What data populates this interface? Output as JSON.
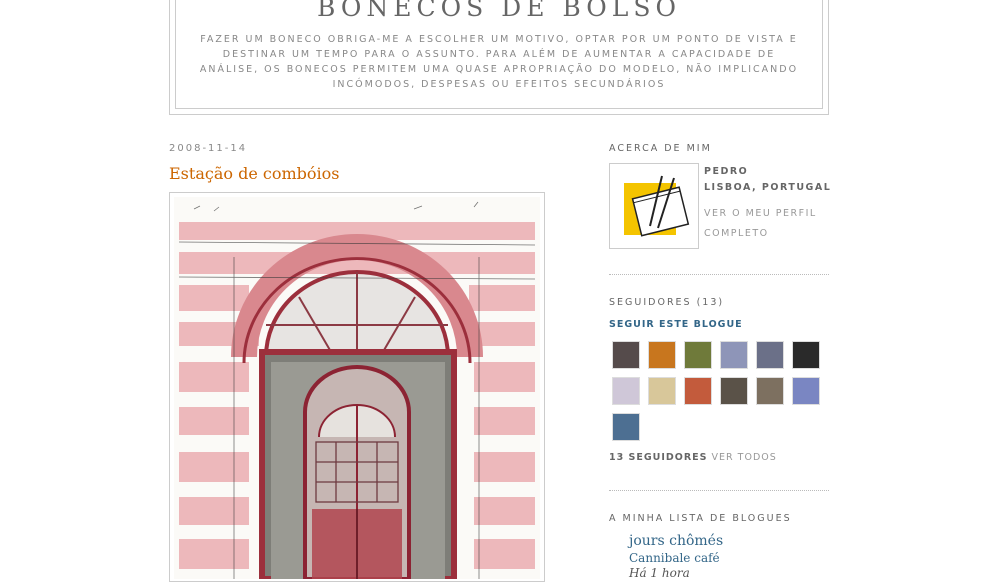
{
  "header": {
    "title": "BONECOS DE BOLSO",
    "description": "FAZER UM BONECO OBRIGA-ME A ESCOLHER UM MOTIVO, OPTAR POR UM PONTO DE VISTA E DESTINAR UM TEMPO PARA O ASSUNTO. PARA ALÉM DE AUMENTAR A CAPACIDADE DE ANÁLISE, OS BONECOS PERMITEM UMA QUASE APROPRIAÇÃO DO MODELO, NÃO IMPLICANDO INCÓMODOS, DESPESAS OU EFEITOS SECUNDÁRIOS"
  },
  "post": {
    "date": "2008-11-14",
    "title": "Estação de combóios"
  },
  "sidebar": {
    "about": {
      "heading": "ACERCA DE MIM",
      "name": "PEDRO",
      "location": "LISBOA, PORTUGAL",
      "profile_link_line1": "VER O MEU PERFIL",
      "profile_link_line2": "COMPLETO"
    },
    "followers": {
      "heading": "SEGUIDORES (13)",
      "follow_link": "SEGUIR ESTE BLOGUE",
      "count_label": "13 SEGUIDORES",
      "see_all": "VER TODOS",
      "avatar_colors": [
        "#554b4b",
        "#c8761e",
        "#6f7a3a",
        "#8e95b8",
        "#6b7088",
        "#2a2a2a",
        "#cfc7d8",
        "#d8c79a",
        "#c35b3c",
        "#5a5248",
        "#7d7060",
        "#7a86c2",
        "#4d6f92"
      ]
    },
    "bloglist": {
      "heading": "A MINHA LISTA DE BLOGUES",
      "items": [
        {
          "title": "jours chômés",
          "latest_post": "Cannibale café",
          "time": "Há 1 hora"
        }
      ]
    }
  },
  "colors": {
    "accent": "#cc6600",
    "link": "#336688",
    "border": "#cccccc"
  }
}
